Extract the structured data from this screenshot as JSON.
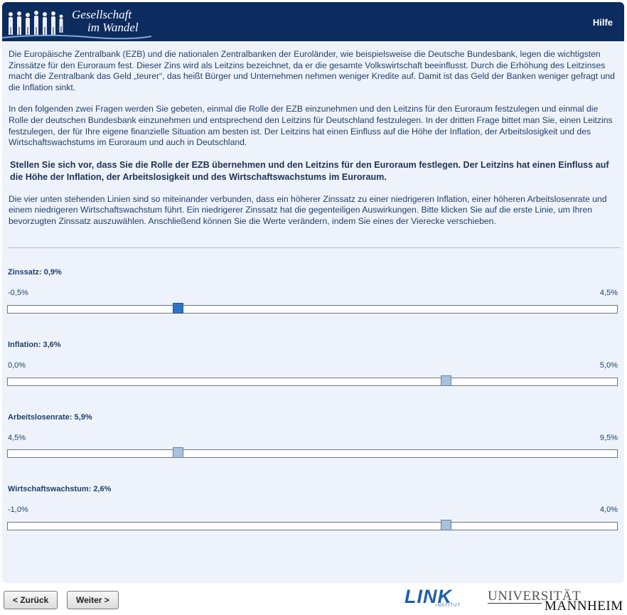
{
  "header": {
    "logo_line1": "Gesellschaft",
    "logo_line2": "im Wandel",
    "help_label": "Hilfe"
  },
  "intro": {
    "p1": "Die Europäische Zentralbank (EZB) und die nationalen Zentralbanken der Euroländer, wie beispielsweise die Deutsche Bundesbank, legen die wichtigsten Zinssätze für den Euroraum fest. Dieser Zins wird als Leitzins bezeichnet, da er die gesamte Volkswirtschaft beeinflusst. Durch die Erhöhung des Leitzinses macht die Zentralbank das Geld „teurer“, das heißt Bürger und Unternehmen nehmen weniger Kredite auf. Damit ist das Geld der Banken weniger gefragt und die Inflation sinkt.",
    "p2": "In den folgenden zwei Fragen werden Sie gebeten, einmal die Rolle der EZB einzunehmen und den Leitzins für den Euroraum festzulegen und einmal die Rolle der deutschen Bundesbank einzunehmen und entsprechend den Leitzins für Deutschland festzulegen. In der dritten Frage bittet man Sie, einen Leitzins festzulegen, der für Ihre eigene finanzielle Situation am besten ist. Der Leitzins hat einen Einfluss auf die Höhe der Inflation, der Arbeitslosigkeit und des Wirtschaftswachstums im Euroraum und auch in Deutschland.",
    "question": "Stellen Sie sich vor, dass Sie die Rolle der EZB übernehmen und den Leitzins für den Euroraum festlegen. Der Leitzins hat einen Einfluss auf die Höhe der Inflation, der Arbeitslosigkeit und des Wirtschaftswachstums im Euroraum.",
    "instructions": "Die vier unten stehenden Linien sind so miteinander verbunden, dass ein höherer Zinssatz zu einer niedrigeren Inflation, einer höheren Arbeitslosenrate und einem niedrigeren Wirtschaftswachstum führt. Ein niedrigerer Zinssatz hat die gegenteiligen Auswirkungen. Bitte klicken Sie auf die erste Linie, um Ihren bevorzugten Zinssatz auszuwählen. Anschließend können Sie die Werte verändern, indem Sie eines der Vierecke verschieben."
  },
  "sliders": [
    {
      "label": "Zinssatz: 0,9%",
      "min_label": "-0,5%",
      "max_label": "4,5%",
      "min": -0.5,
      "max": 4.5,
      "value": 0.9,
      "active": true
    },
    {
      "label": "Inflation: 3,6%",
      "min_label": "0,0%",
      "max_label": "5,0%",
      "min": 0.0,
      "max": 5.0,
      "value": 3.6,
      "active": false
    },
    {
      "label": "Arbeitslosenrate: 5,9%",
      "min_label": "4,5%",
      "max_label": "9,5%",
      "min": 4.5,
      "max": 9.5,
      "value": 5.9,
      "active": false
    },
    {
      "label": "Wirtschaftswachstum: 2,6%",
      "min_label": "-1,0%",
      "max_label": "4,0%",
      "min": -1.0,
      "max": 4.0,
      "value": 2.6,
      "active": false
    }
  ],
  "nav": {
    "back_label": "< Zurück",
    "next_label": "Weiter >"
  },
  "footer": {
    "link_logo": "LINK",
    "link_sub": "INSTITUT",
    "uni_line1": "UNIVERSITÄT",
    "uni_line2": "MANNHEIM"
  },
  "colors": {
    "header_bg": "#0c2b5e",
    "panel_bg": "#eef3fb",
    "text": "#1f3f6b",
    "handle_active": "#2f74c3",
    "handle_inactive": "#a7c1e0"
  }
}
